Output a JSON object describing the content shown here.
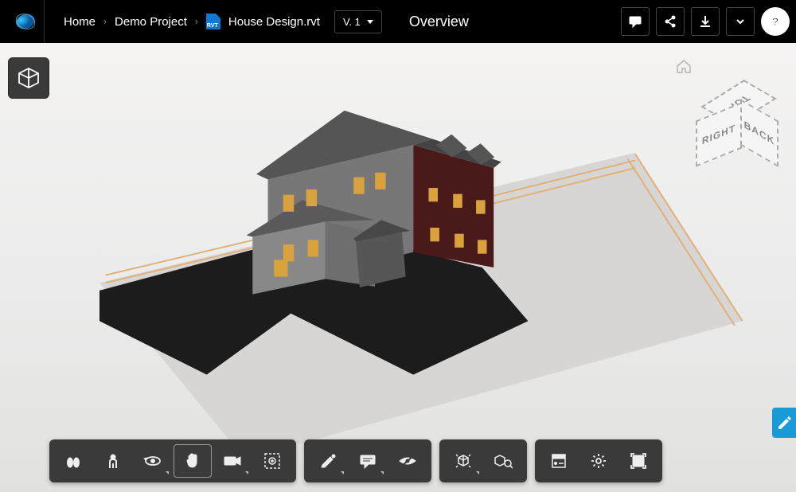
{
  "breadcrumb": {
    "home": "Home",
    "project": "Demo Project",
    "file": "House Design.rvt",
    "file_badge": "RVT"
  },
  "version": {
    "label": "V. 1"
  },
  "page_title": "Overview",
  "header_actions": {
    "comments": "comments-icon",
    "share": "share-icon",
    "download": "download-icon",
    "more": "chevron-down-icon",
    "help": "help-icon"
  },
  "viewcube": {
    "top": "TOP",
    "right": "RIGHT",
    "back": "BACK"
  },
  "toolbar": {
    "group1": [
      "walk-icon",
      "first-person-icon",
      "orbit-icon",
      "pan-icon",
      "camera-icon",
      "zoom-window-icon"
    ],
    "group2": [
      "markup-icon",
      "comment-icon",
      "hide-icon"
    ],
    "group3": [
      "explode-icon",
      "model-browser-icon"
    ],
    "group4": [
      "properties-icon",
      "settings-icon",
      "fullscreen-icon"
    ]
  },
  "active_tool": "pan-icon"
}
